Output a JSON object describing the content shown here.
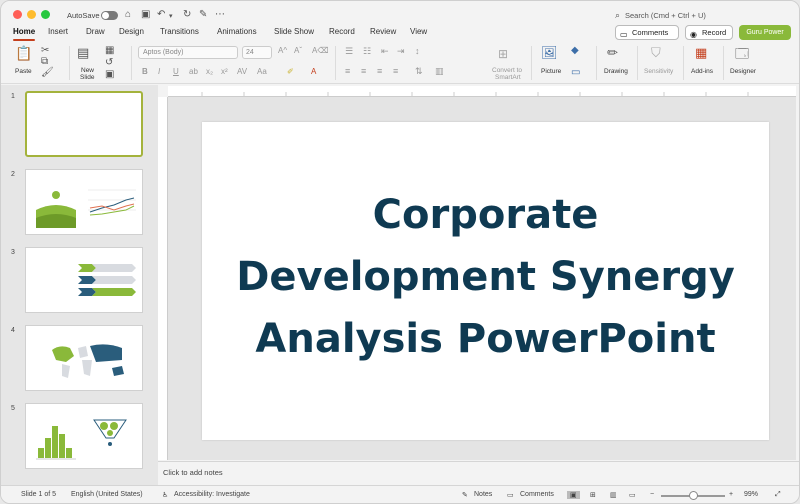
{
  "titlebar": {
    "autosave_label": "AutoSave",
    "search_placeholder": "Search (Cmd + Ctrl + U)"
  },
  "tabs": [
    "Home",
    "Insert",
    "Draw",
    "Design",
    "Transitions",
    "Animations",
    "Slide Show",
    "Record",
    "Review",
    "View"
  ],
  "actions": {
    "comments": "Comments",
    "record": "Record",
    "guru": "Guru Power"
  },
  "ribbon": {
    "paste": "Paste",
    "new_slide_1": "New",
    "new_slide_2": "Slide",
    "font_name": "Aptos (Body)",
    "font_size": "24",
    "convert_1": "Convert to",
    "convert_2": "SmartArt",
    "picture": "Picture",
    "drawing": "Drawing",
    "sensitivity": "Sensitivity",
    "addins": "Add-ins",
    "designer": "Designer"
  },
  "thumbnails": [
    "1",
    "2",
    "3",
    "4",
    "5"
  ],
  "slide": {
    "title": "Corporate\nDevelopment Synergy\nAnalysis PowerPoint"
  },
  "notes_placeholder": "Click to add notes",
  "status": {
    "slide_of": "Slide 1 of 5",
    "language": "English (United States)",
    "accessibility": "Accessibility: Investigate",
    "notes": "Notes",
    "comments": "Comments",
    "zoom": "99%"
  },
  "colors": {
    "accent_tab": "#c43e1c",
    "guru_button": "#8ab93a",
    "title_text": "#0f3a52",
    "thumb_green": "#8ab93a",
    "thumb_navy": "#2a5d7c"
  }
}
